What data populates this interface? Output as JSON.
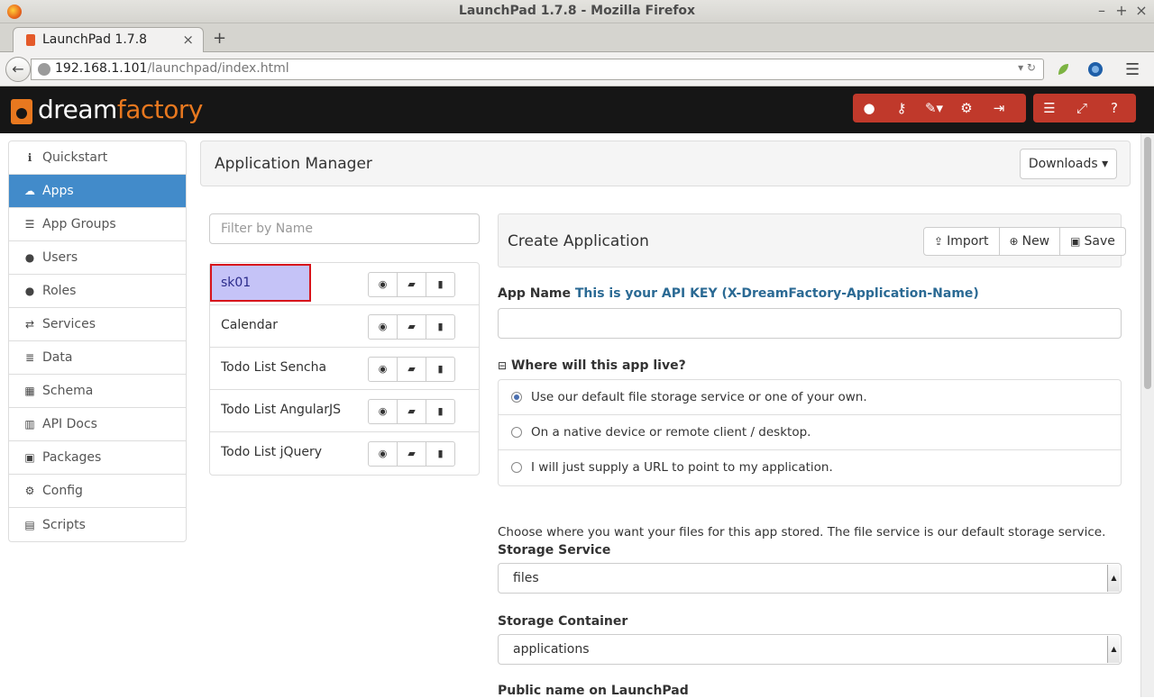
{
  "browser": {
    "window_title": "LaunchPad 1.7.8 - Mozilla Firefox",
    "tab_label": "LaunchPad 1.7.8",
    "url_host": "192.168.1.101",
    "url_path": "/launchpad/index.html",
    "window_controls": [
      "–",
      "+",
      "×"
    ],
    "new_tab": "+",
    "tab_close": "×"
  },
  "header": {
    "logo_dream": "dream",
    "logo_factory": "factory",
    "group1_icons": [
      "user-icon",
      "key-icon",
      "wrench-icon",
      "gear-icon",
      "sign-out-icon"
    ],
    "group2_icons": [
      "list-icon",
      "fullscreen-icon",
      "help-icon"
    ],
    "accent_color": "#c0392b",
    "brand_color": "#e8781f"
  },
  "sidebar": {
    "items": [
      {
        "label": "Quickstart",
        "icon": "info-icon",
        "glyph": "ℹ"
      },
      {
        "label": "Apps",
        "icon": "cloud-icon",
        "glyph": "☁",
        "active": true
      },
      {
        "label": "App Groups",
        "icon": "list-icon",
        "glyph": "☰"
      },
      {
        "label": "Users",
        "icon": "user-icon",
        "glyph": "●"
      },
      {
        "label": "Roles",
        "icon": "users-icon",
        "glyph": "●"
      },
      {
        "label": "Services",
        "icon": "exchange-icon",
        "glyph": "⇄"
      },
      {
        "label": "Data",
        "icon": "database-icon",
        "glyph": "≣"
      },
      {
        "label": "Schema",
        "icon": "table-icon",
        "glyph": "▦"
      },
      {
        "label": "API Docs",
        "icon": "bank-icon",
        "glyph": "▥"
      },
      {
        "label": "Packages",
        "icon": "gift-icon",
        "glyph": "▣"
      },
      {
        "label": "Config",
        "icon": "gear-icon",
        "glyph": "⚙"
      },
      {
        "label": "Scripts",
        "icon": "file-icon",
        "glyph": "▤"
      }
    ]
  },
  "main": {
    "title": "Application Manager",
    "downloads_label": "Downloads ▾",
    "filter_placeholder": "Filter by Name",
    "apps": [
      {
        "name": "sk01",
        "selected": true
      },
      {
        "name": "Calendar"
      },
      {
        "name": "Todo List Sencha"
      },
      {
        "name": "Todo List AngularJS"
      },
      {
        "name": "Todo List jQuery"
      }
    ],
    "row_actions": [
      "eye-icon",
      "folder-open-icon",
      "trash-icon"
    ]
  },
  "create": {
    "title": "Create Application",
    "import_label": "Import",
    "new_label": "New",
    "save_label": "Save",
    "app_name_label": "App Name",
    "app_name_hint": "This is your API KEY (X-DreamFactory-Application-Name)",
    "app_name_value": "",
    "where_label": "Where will this app live?",
    "options": [
      {
        "label": "Use our default file storage service or one of your own.",
        "checked": true
      },
      {
        "label": "On a native device or remote client / desktop.",
        "checked": false
      },
      {
        "label": "I will just supply a URL to point to my application.",
        "checked": false
      }
    ],
    "storage_help": "Choose where you want your files for this app stored. The file service is our default storage service.",
    "storage_service_label": "Storage Service",
    "storage_service_value": "files",
    "storage_container_label": "Storage Container",
    "storage_container_value": "applications",
    "public_name_label": "Public name on LaunchPad"
  }
}
